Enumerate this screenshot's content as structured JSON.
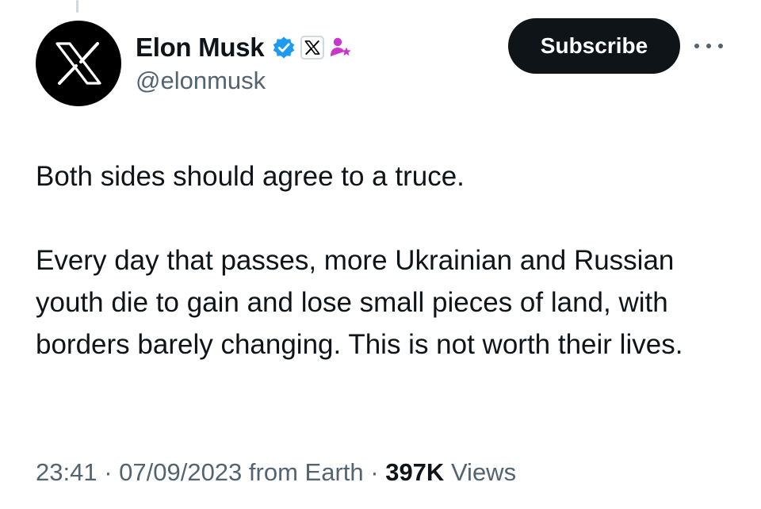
{
  "tweet": {
    "author": {
      "display_name": "Elon Musk",
      "handle": "@elonmusk",
      "avatar_icon": "x-logo-icon",
      "badges": [
        "verified-badge-icon",
        "x-affiliate-badge-icon",
        "user-star-icon"
      ]
    },
    "subscribe_label": "Subscribe",
    "body": [
      "Both sides should agree to a truce.",
      "Every day that passes, more Ukrainian and Russian youth die to gain and lose small pieces of land, with borders barely changing. This is not worth their lives."
    ],
    "meta": {
      "time": "23:41",
      "separator": " · ",
      "date": "07/09/2023",
      "source": "from Earth",
      "views_count": "397K",
      "views_label": "Views"
    }
  },
  "colors": {
    "text": "#0f1419",
    "secondary": "#536471",
    "verified_blue": "#1d9bf0",
    "purple_icon": "#c936cc",
    "button_bg": "#0f1419"
  }
}
